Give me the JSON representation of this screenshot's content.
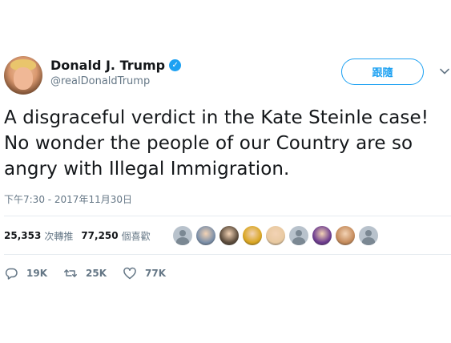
{
  "user": {
    "display_name": "Donald J. Trump",
    "handle": "@realDonaldTrump",
    "verified": true
  },
  "follow_button": {
    "label": "跟隨"
  },
  "tweet": {
    "text": "A disgraceful verdict in the Kate Steinle case! No wonder the people of our Country are so angry with Illegal Immigration.",
    "timestamp": "下午7:30 - 2017年11月30日"
  },
  "stats": {
    "retweets": {
      "count": "25,353",
      "label": "次轉推"
    },
    "likes": {
      "count": "77,250",
      "label": "個喜歡"
    }
  },
  "liker_avatars": [
    {
      "kind": "default",
      "color": "#b8c2cc"
    },
    {
      "kind": "photo",
      "color": "#7a8ea8"
    },
    {
      "kind": "photo",
      "color": "#5a4a3a"
    },
    {
      "kind": "photo",
      "color": "#d9a520"
    },
    {
      "kind": "photo",
      "color": "#e8c9a0"
    },
    {
      "kind": "default",
      "color": "#b8c2cc"
    },
    {
      "kind": "photo",
      "color": "#6b3a8e"
    },
    {
      "kind": "photo",
      "color": "#c48a5a"
    },
    {
      "kind": "default",
      "color": "#b8c2cc"
    }
  ],
  "actions": {
    "reply": {
      "icon": "reply-icon",
      "count": "19K"
    },
    "retweet": {
      "icon": "retweet-icon",
      "count": "25K"
    },
    "like": {
      "icon": "heart-icon",
      "count": "77K"
    }
  },
  "colors": {
    "accent": "#1da1f2",
    "muted": "#657786",
    "text": "#14171a",
    "divider": "#e6ecf0"
  }
}
